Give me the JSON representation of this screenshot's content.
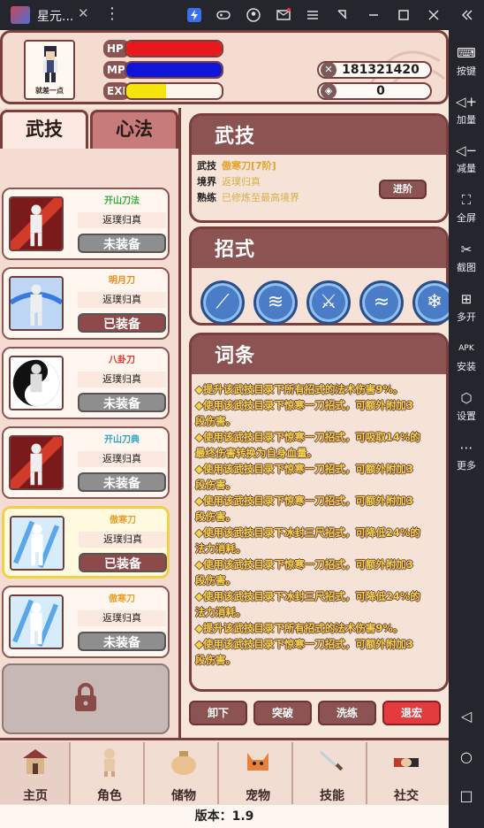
{
  "titlebar": {
    "tab_title": "星元...",
    "tab_close": "✕",
    "menu": "⋮",
    "icons": [
      "lightning-icon",
      "gamepad-icon",
      "account-icon",
      "mail-icon",
      "hamburger-icon",
      "resize-icon",
      "minimize-icon",
      "maximize-icon",
      "close-icon",
      "collapse-icon"
    ]
  },
  "emulator_sidebar": {
    "items": [
      {
        "label": "按键",
        "icon": "keyboard-icon"
      },
      {
        "label": "加量",
        "icon": "volume-up-icon"
      },
      {
        "label": "减量",
        "icon": "volume-down-icon"
      },
      {
        "label": "全屏",
        "icon": "fullscreen-icon"
      },
      {
        "label": "截图",
        "icon": "scissors-icon"
      },
      {
        "label": "多开",
        "icon": "multi-instance-icon"
      },
      {
        "label": "安装",
        "icon": "apk-icon"
      },
      {
        "label": "设置",
        "icon": "settings-icon"
      },
      {
        "label": "更多",
        "icon": "more-icon"
      }
    ],
    "nav": [
      "back-icon",
      "home-icon",
      "recents-icon"
    ]
  },
  "status": {
    "player_name": "就差一点",
    "hp_label": "HP",
    "mp_label": "MP",
    "exp_label": "EXP",
    "hp_fraction": 1.0,
    "mp_fraction": 1.0,
    "exp_fraction": 0.42,
    "coins": "181321420",
    "gems": "0",
    "colors": {
      "hp": "#e8191d",
      "mp": "#1016d8",
      "exp": "#f5e40a"
    }
  },
  "left_tabs": {
    "skills": "武技",
    "mind": "心法"
  },
  "skill_cards": [
    {
      "title": "开山刀法",
      "title_color": "#2fae3a",
      "realm": "返璞归真",
      "equip": "未装备",
      "equipped": false,
      "style": "red"
    },
    {
      "title": "明月刀",
      "title_color": "#e38a1f",
      "realm": "返璞归真",
      "equip": "已装备",
      "equipped": true,
      "style": "blue"
    },
    {
      "title": "八卦刀",
      "title_color": "#e0332b",
      "realm": "返璞归真",
      "equip": "未装备",
      "equipped": false,
      "style": "yin"
    },
    {
      "title": "开山刀典",
      "title_color": "#2aa4c8",
      "realm": "返璞归真",
      "equip": "未装备",
      "equipped": false,
      "style": "red"
    },
    {
      "title": "傲寒刀",
      "title_color": "#e3a22c",
      "realm": "返璞归真",
      "equip": "已装备",
      "equipped": true,
      "style": "ice"
    },
    {
      "title": "傲寒刀",
      "title_color": "#e3a22c",
      "realm": "返璞归真",
      "equip": "未装备",
      "equipped": false,
      "style": "ice"
    }
  ],
  "detail": {
    "heading": "武技",
    "rows": [
      {
        "k": "武技",
        "v": "傲寒刀[7阶]"
      },
      {
        "k": "境界",
        "v": "返璞归真"
      },
      {
        "k": "熟练",
        "v": "已修炼至最高境界"
      }
    ],
    "advance": "进阶"
  },
  "moves": {
    "heading": "招式",
    "items": [
      "ice-blade-icon",
      "ice-slash-icon",
      "ice-sword-icon",
      "ice-wave-icon",
      "ice-shard-icon"
    ]
  },
  "affixes": {
    "heading": "词条",
    "lines": [
      "◆提升该武技目录下所有招式的法术伤害9%。",
      "◆使用该武技目录下惊寒一刀招式，可额外附加3",
      "段伤害。",
      "◆使用该武技目录下惊寒一刀招式，可吸取14%的",
      "最终伤害转换为自身血量。",
      "◆使用该武技目录下惊寒一刀招式，可额外附加3",
      "段伤害。",
      "◆使用该武技目录下惊寒一刀招式，可额外附加3",
      "段伤害。",
      "◆使用该武技目录下冰封三尺招式，可降低24%的",
      "法力消耗。",
      "◆使用该武技目录下惊寒一刀招式，可额外附加3",
      "段伤害。",
      "◆使用该武技目录下冰封三尺招式，可降低24%的",
      "法力消耗。",
      "◆提升该武技目录下所有招式的法术伤害9%。",
      "◆使用该武技目录下惊寒一刀招式，可额外附加3",
      "段伤害。"
    ]
  },
  "actions": {
    "unequip": "卸下",
    "breakthrough": "突破",
    "refine": "洗练",
    "retreat": "退宏"
  },
  "bottom_nav": [
    {
      "label": "主页",
      "icon": "house-icon",
      "active": true
    },
    {
      "label": "角色",
      "icon": "character-icon",
      "active": false
    },
    {
      "label": "储物",
      "icon": "bag-icon",
      "active": false
    },
    {
      "label": "宠物",
      "icon": "fox-pet-icon",
      "active": false
    },
    {
      "label": "技能",
      "icon": "sword-icon",
      "active": false
    },
    {
      "label": "社交",
      "icon": "handshake-icon",
      "active": false
    }
  ],
  "version": "版本：1.9"
}
